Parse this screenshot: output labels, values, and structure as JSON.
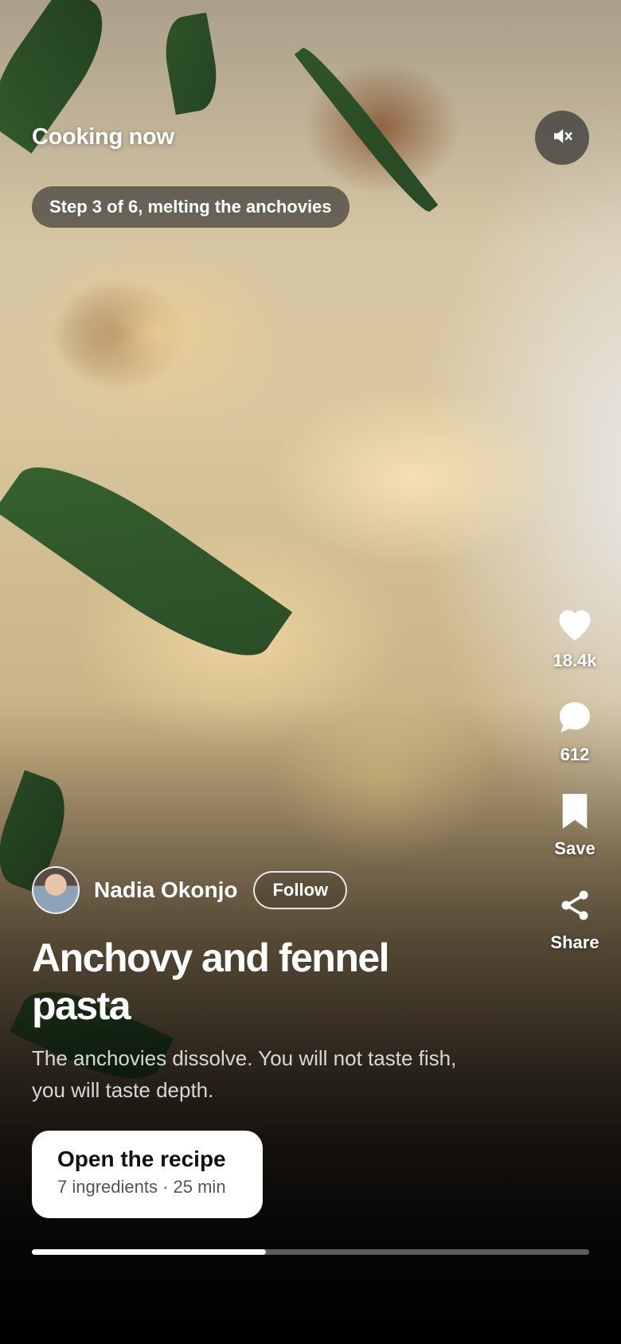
{
  "header": {
    "title": "Cooking now",
    "mute_icon": "speaker-muted-icon"
  },
  "step": {
    "label": "Step 3 of 6, melting the anchovies"
  },
  "actions": {
    "like": {
      "icon": "heart-icon",
      "count": "18.4k"
    },
    "comment": {
      "icon": "comment-icon",
      "count": "612"
    },
    "save": {
      "icon": "bookmark-icon",
      "label": "Save"
    },
    "share": {
      "icon": "share-icon",
      "label": "Share"
    }
  },
  "author": {
    "name": "Nadia Okonjo",
    "follow_label": "Follow"
  },
  "post": {
    "title": "Anchovy and fennel pasta",
    "description": "The anchovies dissolve. You will not taste fish, you will taste depth."
  },
  "cta": {
    "title": "Open the recipe",
    "meta": "7 ingredients · 25 min"
  },
  "playback": {
    "progress": 0.42
  },
  "colors": {
    "accent": "#ffffff",
    "overlay": "#000000"
  }
}
